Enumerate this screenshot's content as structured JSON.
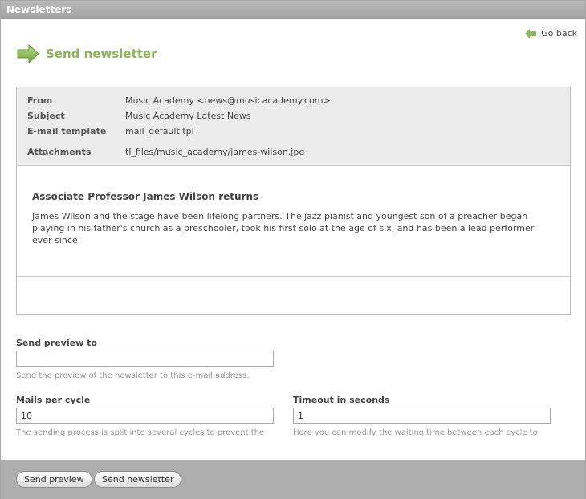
{
  "window": {
    "title": "Newsletters"
  },
  "nav": {
    "go_back_label": "Go back"
  },
  "page": {
    "title": "Send newsletter"
  },
  "preview": {
    "from_label": "From",
    "from_value": "Music Academy <news@musicacademy.com>",
    "subject_label": "Subject",
    "subject_value": "Music Academy Latest News",
    "template_label": "E-mail template",
    "template_value": "mail_default.tpl",
    "attachments_label": "Attachments",
    "attachments_value": "tl_files/music_academy/james-wilson.jpg",
    "headline": "Associate Professor James Wilson returns",
    "body": "James Wilson and the stage have been lifelong partners. The jazz pianist and youngest son of a preacher began playing in his father's church as a preschooler, took his first solo at the age of six, and has been a lead performer ever since."
  },
  "form": {
    "preview_to_label": "Send preview to",
    "preview_to_value": "",
    "preview_to_help": "Send the preview of the newsletter to this e-mail address.",
    "mails_per_cycle_label": "Mails per cycle",
    "mails_per_cycle_value": "10",
    "mails_per_cycle_help": "The sending process is split into several cycles to prevent the",
    "timeout_label": "Timeout in seconds",
    "timeout_value": "1",
    "timeout_help": "Here you can modify the waiting time between each cycle to"
  },
  "actions": {
    "send_preview_label": "Send preview",
    "send_newsletter_label": "Send newsletter"
  },
  "colors": {
    "accent": "#8ab858",
    "titlebar": "#aeaeae",
    "footer": "#aeaeae"
  }
}
